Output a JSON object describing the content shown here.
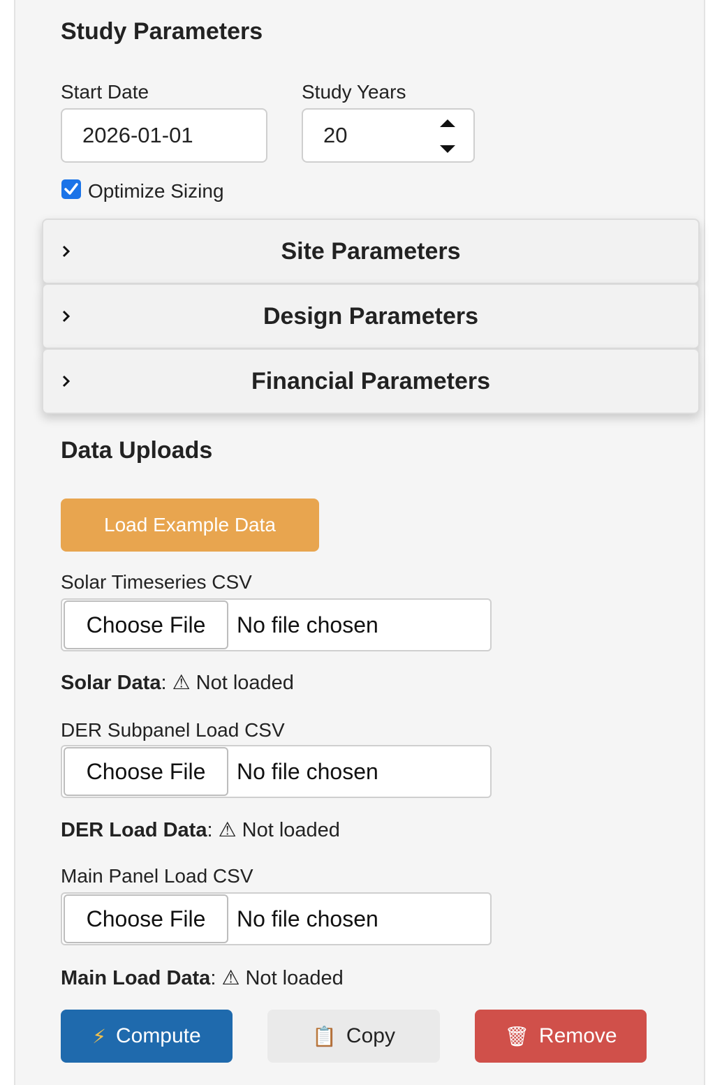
{
  "study": {
    "title": "Study Parameters",
    "start_date_label": "Start Date",
    "start_date_value": "2026-01-01",
    "study_years_label": "Study Years",
    "study_years_value": "20",
    "optimize_label": "Optimize Sizing",
    "optimize_checked": true
  },
  "accordion": {
    "site": "Site Parameters",
    "design": "Design Parameters",
    "financial": "Financial Parameters"
  },
  "uploads": {
    "title": "Data Uploads",
    "load_example_label": "Load Example Data",
    "solar": {
      "label": "Solar Timeseries CSV",
      "button": "Choose File",
      "status": "No file chosen",
      "data_label": "Solar Data",
      "data_status": "⚠ Not loaded"
    },
    "der": {
      "label": "DER Subpanel Load CSV",
      "button": "Choose File",
      "status": "No file chosen",
      "data_label": "DER Load Data",
      "data_status": "⚠ Not loaded"
    },
    "main": {
      "label": "Main Panel Load CSV",
      "button": "Choose File",
      "status": "No file chosen",
      "data_label": "Main Load Data",
      "data_status": "⚠ Not loaded"
    }
  },
  "actions": {
    "compute": "Compute",
    "compute_icon": "⚡",
    "copy": "Copy",
    "copy_icon": "📋",
    "remove": "Remove",
    "remove_icon": "🗑"
  },
  "colors": {
    "example_button": "#e8a54f",
    "compute_button": "#1f6aad",
    "copy_button": "#eaeaea",
    "remove_button": "#d0504a",
    "checkbox": "#1a73e8"
  }
}
